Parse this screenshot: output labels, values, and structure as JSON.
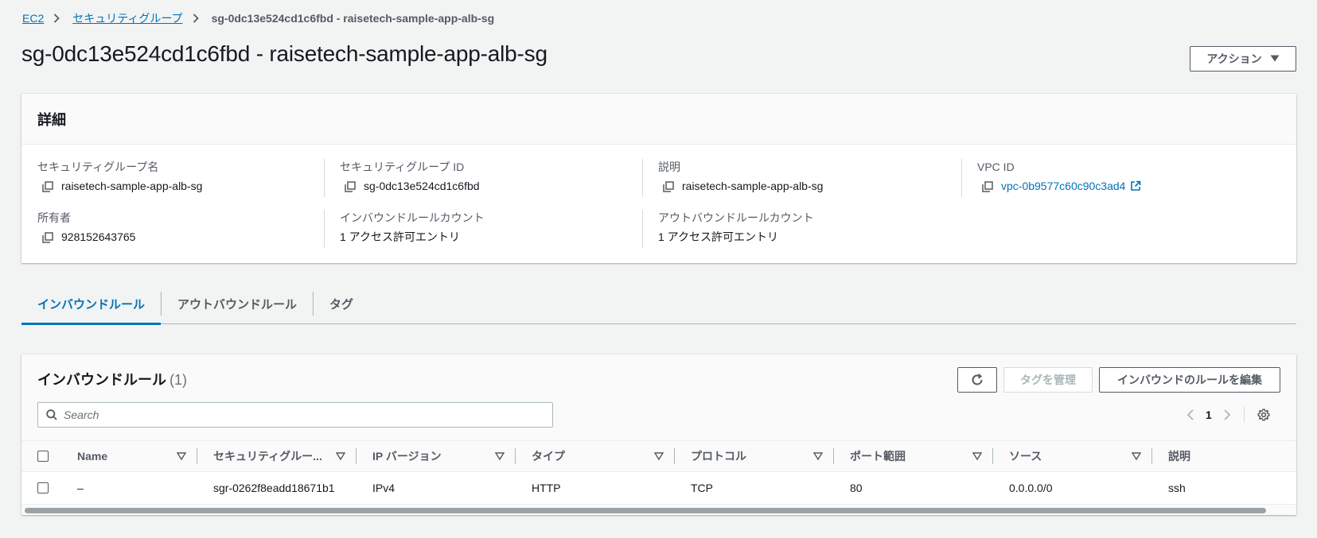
{
  "breadcrumb": {
    "items": [
      "EC2",
      "セキュリティグループ"
    ],
    "current": "sg-0dc13e524cd1c6fbd - raisetech-sample-app-alb-sg"
  },
  "page": {
    "title": "sg-0dc13e524cd1c6fbd - raisetech-sample-app-alb-sg",
    "actions_label": "アクション"
  },
  "details": {
    "header": "詳細",
    "sg_name_label": "セキュリティグループ名",
    "sg_name_value": "raisetech-sample-app-alb-sg",
    "sg_id_label": "セキュリティグループ ID",
    "sg_id_value": "sg-0dc13e524cd1c6fbd",
    "description_label": "説明",
    "description_value": "raisetech-sample-app-alb-sg",
    "vpc_label": "VPC ID",
    "vpc_value": "vpc-0b9577c60c90c3ad4",
    "owner_label": "所有者",
    "owner_value": "928152643765",
    "inbound_count_label": "インバウンドルールカウント",
    "inbound_count_value": "1 アクセス許可エントリ",
    "outbound_count_label": "アウトバウンドルールカウント",
    "outbound_count_value": "1 アクセス許可エントリ"
  },
  "tabs": [
    "インバウンドルール",
    "アウトバウンドルール",
    "タグ"
  ],
  "rules": {
    "title": "インバウンドルール",
    "count": "(1)",
    "manage_tags_label": "タグを管理",
    "edit_label": "インバウンドのルールを編集",
    "search_placeholder": "Search",
    "page_number": "1",
    "columns": [
      "Name",
      "セキュリティグルー...",
      "IP バージョン",
      "タイプ",
      "プロトコル",
      "ポート範囲",
      "ソース",
      "説明"
    ],
    "rows": [
      [
        "–",
        "sgr-0262f8eadd18671b1",
        "IPv4",
        "HTTP",
        "TCP",
        "80",
        "0.0.0.0/0",
        "ssh"
      ]
    ]
  },
  "colors": {
    "link": "#0073bb",
    "background": "#f2f3f3",
    "text": "#16191f"
  }
}
